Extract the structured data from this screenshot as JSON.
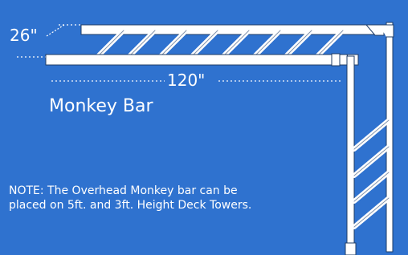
{
  "diagram": {
    "depth_label": "26\"",
    "length_label": "120\"",
    "title": "Monkey Bar",
    "note": "NOTE: The Overhead Monkey bar can be placed on 5ft. and 3ft. Height Deck Towers."
  },
  "colors": {
    "background": "#2f72cf",
    "foreground": "#ffffff",
    "outline": "#1f3c66"
  }
}
